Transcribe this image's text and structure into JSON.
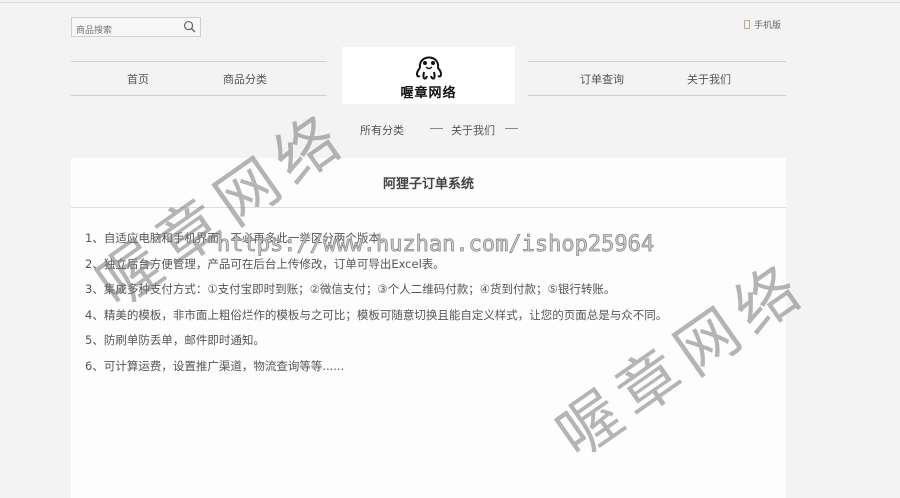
{
  "search": {
    "placeholder": "商品搜索"
  },
  "mobile_link": "手机版",
  "nav": {
    "left": [
      "首页",
      "商品分类"
    ],
    "right": [
      "订单查询",
      "关于我们"
    ]
  },
  "logo": {
    "text": "喔章网络"
  },
  "subnav": [
    "所有分类",
    "关于我们"
  ],
  "panel": {
    "title": "阿狸子订单系统",
    "items": [
      "1、自适应电脑和手机界面，不必再多此一举区分两个版本。",
      "2、独立后台方便管理，产品可在后台上传修改，订单可导出Excel表。",
      "3、集成多种支付方式：①支付宝即时到账；②微信支付；③个人二维码付款；④货到付款；⑤银行转账。",
      "4、精美的模板，非市面上粗俗烂作的模板与之可比；模板可随意切换且能自定义样式，让您的页面总是与众不同。",
      "5、防刷单防丢单，邮件即时通知。",
      "6、可计算运费，设置推广渠道，物流查询等等......"
    ]
  },
  "watermark": {
    "text": "喔章网络",
    "url": "https://www.huzhan.com/ishop25964"
  }
}
